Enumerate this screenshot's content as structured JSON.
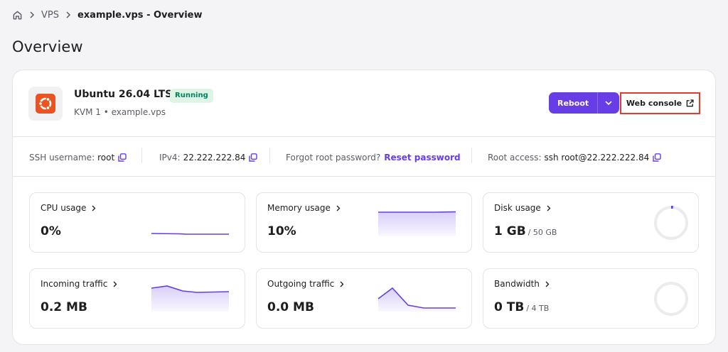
{
  "breadcrumb": {
    "items": [
      "VPS",
      "example.vps - Overview"
    ]
  },
  "page": {
    "title": "Overview"
  },
  "server": {
    "os_name": "Ubuntu 26.04 LTS",
    "status": "Running",
    "subtitle": "KVM 1 • example.vps",
    "reboot_label": "Reboot",
    "web_console_label": "Web console"
  },
  "info": {
    "ssh_label": "SSH username:",
    "ssh_value": "root",
    "ipv4_label": "IPv4:",
    "ipv4_value": "22.222.222.84",
    "forgot_label": "Forgot root password?",
    "reset_label": "Reset password",
    "root_label": "Root access:",
    "root_value": "ssh root@22.222.222.84"
  },
  "metrics": {
    "cpu": {
      "label": "CPU usage",
      "value": "0%"
    },
    "memory": {
      "label": "Memory usage",
      "value": "10%"
    },
    "disk": {
      "label": "Disk usage",
      "value": "1 GB",
      "sub": "/ 50 GB",
      "fraction": 0.02
    },
    "incoming": {
      "label": "Incoming traffic",
      "value": "0.2 MB"
    },
    "outgoing": {
      "label": "Outgoing traffic",
      "value": "0.0 MB"
    },
    "bandwidth": {
      "label": "Bandwidth",
      "value": "0 TB",
      "sub": "/ 4 TB",
      "fraction": 0
    }
  },
  "colors": {
    "accent": "#673de6",
    "status_green": "#008361",
    "highlight_red": "#e53b2f",
    "ubuntu_orange": "#e95420"
  }
}
